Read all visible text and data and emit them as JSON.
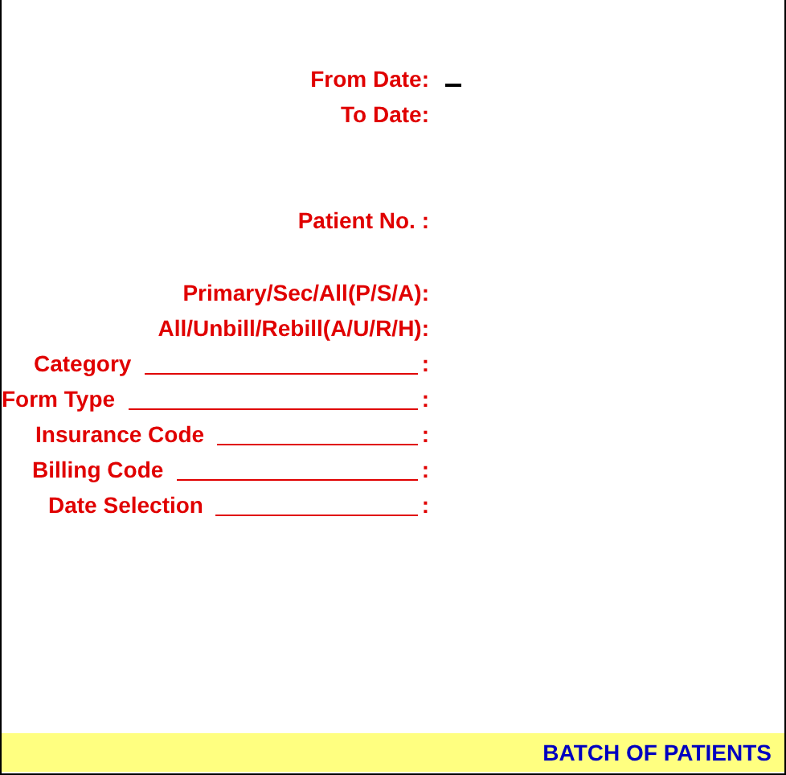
{
  "sections": [
    {
      "fields": [
        {
          "kind": "plain",
          "label": "From Date:",
          "cursor": true
        },
        {
          "kind": "plain",
          "label": "To Date:",
          "cursor": false
        }
      ]
    },
    {
      "fields": [
        {
          "kind": "plain",
          "label": "Patient No. :",
          "cursor": false
        }
      ]
    },
    {
      "fields": [
        {
          "kind": "plain",
          "label": "Primary/Sec/All(P/S/A):",
          "cursor": false
        },
        {
          "kind": "plain",
          "label": "All/Unbill/Rebill(A/U/R/H):",
          "cursor": false
        },
        {
          "kind": "line",
          "label": "Category",
          "colon": ":",
          "cursor": false
        },
        {
          "kind": "line",
          "label": "Form Type",
          "colon": ":",
          "cursor": false
        },
        {
          "kind": "line",
          "label": "Insurance Code",
          "colon": ":",
          "cursor": false
        },
        {
          "kind": "line",
          "label": "Billing Code",
          "colon": ":",
          "cursor": false
        },
        {
          "kind": "line",
          "label": "Date Selection",
          "colon": ":",
          "cursor": false
        }
      ]
    }
  ],
  "status_bar": {
    "title": "BATCH OF PATIENTS"
  }
}
